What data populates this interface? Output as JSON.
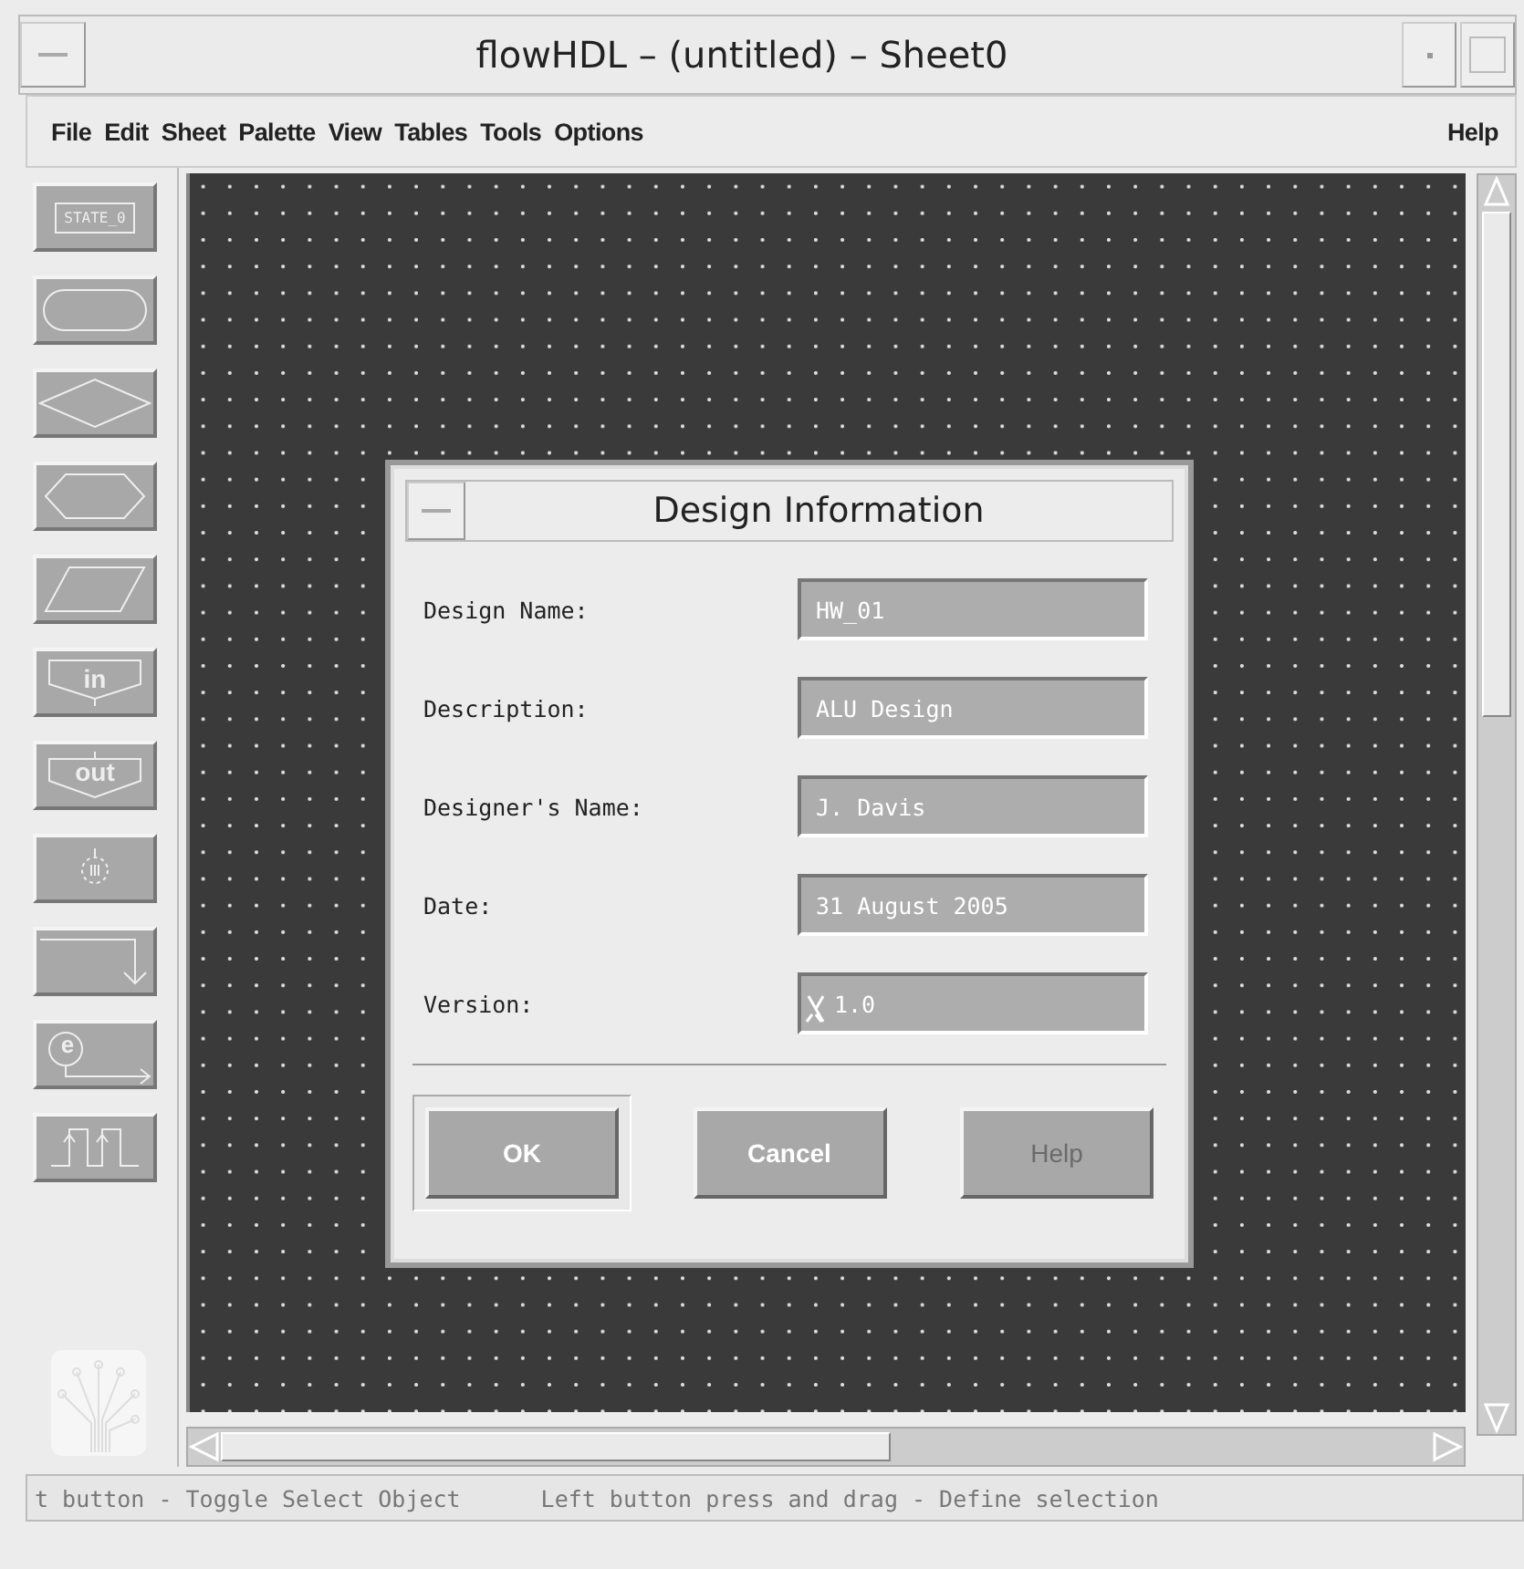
{
  "window": {
    "title": "flowHDL – (untitled) – Sheet0"
  },
  "menu": [
    {
      "label": "File"
    },
    {
      "label": "Edit"
    },
    {
      "label": "Sheet"
    },
    {
      "label": "Palette"
    },
    {
      "label": "View"
    },
    {
      "label": "Tables"
    },
    {
      "label": "Tools"
    },
    {
      "label": "Options"
    }
  ],
  "help_menu": {
    "label": "Help"
  },
  "palette": [
    {
      "kind": "state",
      "label": "STATE_0"
    },
    {
      "kind": "oval"
    },
    {
      "kind": "diamond"
    },
    {
      "kind": "hexagon"
    },
    {
      "kind": "parallelogram"
    },
    {
      "kind": "input",
      "label": "in"
    },
    {
      "kind": "output",
      "label": "out"
    },
    {
      "kind": "clock"
    },
    {
      "kind": "connector"
    },
    {
      "kind": "event",
      "label": "e"
    },
    {
      "kind": "pulse"
    }
  ],
  "dialog": {
    "title": "Design Information",
    "fields": [
      {
        "label": "Design Name:",
        "value": "HW_01",
        "cursor": false
      },
      {
        "label": "Description:",
        "value": "ALU Design",
        "cursor": false
      },
      {
        "label": "Designer's Name:",
        "value": "J. Davis",
        "cursor": false
      },
      {
        "label": "Date:",
        "value": "31 August 2005",
        "cursor": false
      },
      {
        "label": "Version:",
        "value": "1.0",
        "cursor": true
      }
    ],
    "buttons": [
      {
        "label": "OK",
        "default": true,
        "disabled": false
      },
      {
        "label": "Cancel",
        "default": false,
        "disabled": false
      },
      {
        "label": "Help",
        "default": false,
        "disabled": true
      }
    ]
  },
  "status_bar": [
    {
      "text": "t button - Toggle Select Object"
    },
    {
      "text": "Left button press and drag - Define selection"
    }
  ]
}
